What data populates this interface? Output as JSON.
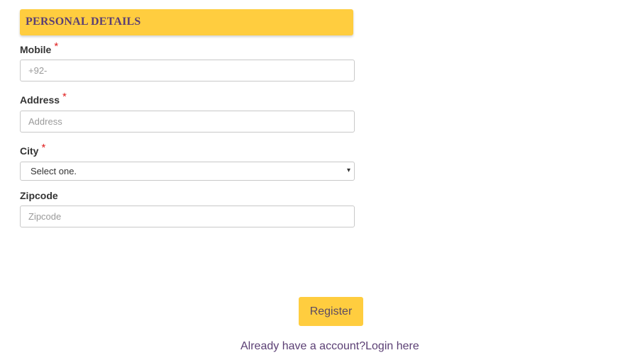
{
  "section": {
    "title": "PERSONAL DETAILS"
  },
  "fields": {
    "mobile": {
      "label": "Mobile",
      "required_mark": "*",
      "placeholder": "+92-"
    },
    "address": {
      "label": "Address",
      "required_mark": "*",
      "placeholder": "Address"
    },
    "city": {
      "label": "City",
      "required_mark": "*",
      "selected": "Select one.",
      "arrow": "▾"
    },
    "zipcode": {
      "label": "Zipcode",
      "placeholder": "Zipcode"
    }
  },
  "actions": {
    "register_label": "Register",
    "login_prompt": "Already have a account?",
    "login_link": "Login here"
  },
  "colors": {
    "accent": "#ffcd3f",
    "header_text": "#5b3f74",
    "required": "#e02020"
  }
}
